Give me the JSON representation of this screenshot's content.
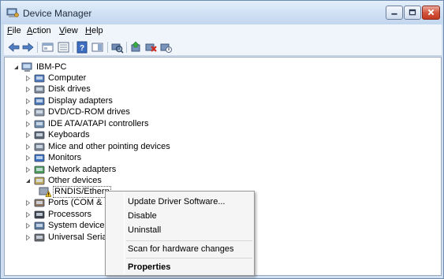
{
  "window": {
    "title": "Device Manager",
    "icon": "device-manager-icon",
    "controls": {
      "minimize": "minimize-icon",
      "maximize": "maximize-icon",
      "close": "close-icon"
    }
  },
  "menu": {
    "items": [
      {
        "accel": "F",
        "rest": "ile"
      },
      {
        "accel": "A",
        "rest": "ction"
      },
      {
        "accel": "V",
        "rest": "iew"
      },
      {
        "accel": "H",
        "rest": "elp"
      }
    ]
  },
  "toolbar": {
    "buttons": [
      "back-icon",
      "forward-icon",
      "properties-console-icon",
      "show-hide-tree-icon",
      "help-icon",
      "action-pane-icon",
      "scan-hardware-icon",
      "update-driver-icon",
      "uninstall-icon",
      "disable-icon"
    ]
  },
  "tree": {
    "root": "IBM-PC",
    "categories": [
      {
        "label": "Computer",
        "icon": "computer-icon"
      },
      {
        "label": "Disk drives",
        "icon": "disk-drive-icon"
      },
      {
        "label": "Display adapters",
        "icon": "display-adapter-icon"
      },
      {
        "label": "DVD/CD-ROM drives",
        "icon": "dvd-drive-icon"
      },
      {
        "label": "IDE ATA/ATAPI controllers",
        "icon": "ide-controller-icon"
      },
      {
        "label": "Keyboards",
        "icon": "keyboard-icon"
      },
      {
        "label": "Mice and other pointing devices",
        "icon": "mouse-icon"
      },
      {
        "label": "Monitors",
        "icon": "monitor-icon"
      },
      {
        "label": "Network adapters",
        "icon": "network-adapter-icon"
      },
      {
        "label": "Other devices",
        "icon": "other-devices-icon"
      },
      {
        "label": "Ports (COM & L",
        "icon": "port-icon"
      },
      {
        "label": "Processors",
        "icon": "processor-icon"
      },
      {
        "label": "System devices",
        "icon": "system-device-icon"
      },
      {
        "label": "Universal Serial I",
        "icon": "usb-icon"
      }
    ],
    "child_device": {
      "label": "RNDIS/Ethern",
      "icon": "warning-device-icon"
    }
  },
  "context_menu": {
    "items": [
      "Update Driver Software...",
      "Disable",
      "Uninstall",
      "Scan for hardware changes",
      "Properties"
    ]
  },
  "colors": {
    "title_bar": "#d3e3f5",
    "close_button": "#c94a32",
    "warning": "#f4c21c"
  }
}
